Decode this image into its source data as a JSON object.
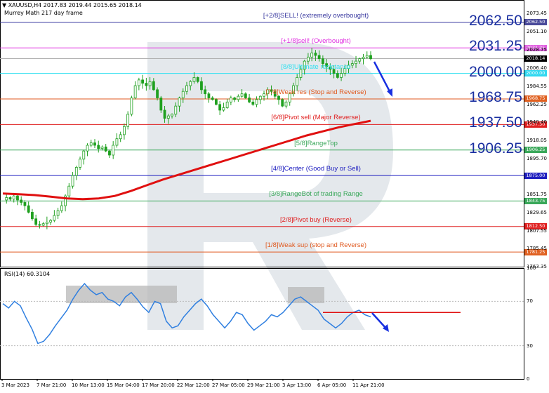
{
  "header": {
    "symbol_line": "XAUUSD,H4  2017.83 2019.44 2015.65 2018.14",
    "indicator": "Murrey Math 217 day frame"
  },
  "rsi_header": "RSI(14) 60.3104",
  "big_labels": [
    "2062.50",
    "2031.25",
    "2000.00",
    "1968.75",
    "1937.50",
    "1906.25"
  ],
  "levels": [
    {
      "price": 2062.5,
      "text": "[+2/8]SELL! (extremely overbought)",
      "color": "#3a3aa0",
      "badge": "2062.50",
      "badge_bg": "#4a4a9a"
    },
    {
      "price": 2031.25,
      "text": "[+1/8]sell! (Overbought)",
      "color": "#e030e0",
      "badge": "2031.25",
      "badge_bg": "#e060e0"
    },
    {
      "price": 2000.0,
      "text": "[8/8]Ultimate resistance",
      "color": "#30e0f0",
      "badge": "2000.00",
      "badge_bg": "#30d8f0"
    },
    {
      "price": 1968.75,
      "text": "[7/8]Weak res (Stop and Reverse)",
      "color": "#e05a20",
      "badge": "1968.75",
      "badge_bg": "#e06020"
    },
    {
      "price": 1937.5,
      "text": "[6/8]Pivot sell (Major Reverse)",
      "color": "#e02020",
      "badge": "1937.50",
      "badge_bg": "#e02020"
    },
    {
      "price": 1906.25,
      "text": "[5/8]RangeTop",
      "color": "#3aa85a",
      "badge": "1906.25",
      "badge_bg": "#3aa85a"
    },
    {
      "price": 1875.0,
      "text": "[4/8]Center (Good Buy or Sell)",
      "color": "#2020c0",
      "badge": "1875.00",
      "badge_bg": "#2020c0"
    },
    {
      "price": 1843.75,
      "text": "[3/8]RangeBot of trading Range",
      "color": "#3aa85a",
      "badge": "1843.75",
      "badge_bg": "#3aa85a"
    },
    {
      "price": 1812.5,
      "text": "[2/8]Pivot buy (Reverse)",
      "color": "#e02020",
      "badge": "1812.50",
      "badge_bg": "#e02020"
    },
    {
      "price": 1781.25,
      "text": "[1/8]Weak sup (stop and Reverse)",
      "color": "#e05a20",
      "badge": "1781.25",
      "badge_bg": "#e06020"
    }
  ],
  "price_ticks": [
    "2073.45",
    "2051.10",
    "2028.75",
    "2006.40",
    "1984.55",
    "1962.25",
    "1940.40",
    "1918.05",
    "1895.70",
    "1851.75",
    "1829.65",
    "1807.55",
    "1785.45",
    "1763.35"
  ],
  "current_price": "2018.14",
  "rsi_ticks": [
    "100",
    "70",
    "30",
    "0"
  ],
  "x_labels": [
    "3 Mar 2023",
    "7 Mar 21:00",
    "10 Mar 13:00",
    "15 Mar 04:00",
    "17 Mar 20:00",
    "22 Mar 12:00",
    "27 Mar 05:00",
    "29 Mar 21:00",
    "3 Apr 13:00",
    "6 Apr 05:00",
    "11 Apr 21:00"
  ],
  "chart_data": {
    "type": "candlestick",
    "symbol": "XAUUSD",
    "timeframe": "H4",
    "ohlc_last": {
      "open": 2017.83,
      "high": 2019.44,
      "low": 2015.65,
      "close": 2018.14
    },
    "ylim": [
      1763.35,
      2083
    ],
    "close_path": [
      1845,
      1848,
      1846,
      1850,
      1845,
      1842,
      1838,
      1830,
      1822,
      1815,
      1814,
      1816,
      1818,
      1820,
      1826,
      1832,
      1838,
      1850,
      1862,
      1875,
      1885,
      1895,
      1905,
      1912,
      1915,
      1912,
      1908,
      1910,
      1905,
      1900,
      1912,
      1920,
      1925,
      1935,
      1950,
      1970,
      1985,
      1992,
      1988,
      1985,
      1990,
      1980,
      1970,
      1955,
      1945,
      1948,
      1950,
      1960,
      1970,
      1978,
      1985,
      1990,
      1995,
      1990,
      1980,
      1975,
      1970,
      1968,
      1962,
      1955,
      1958,
      1965,
      1970,
      1968,
      1972,
      1975,
      1970,
      1965,
      1962,
      1968,
      1972,
      1975,
      1980,
      1978,
      1972,
      1968,
      1960,
      1965,
      1975,
      1985,
      1995,
      2005,
      2015,
      2020,
      2025,
      2022,
      2018,
      2012,
      2008,
      2005,
      2000,
      1995,
      2000,
      2006,
      2010,
      2012,
      2015,
      2018,
      2020,
      2022,
      2018
    ],
    "ma_label": "Murrey Math 217 day frame",
    "moving_average": [
      1853,
      1852,
      1851,
      1849,
      1847,
      1846,
      1847,
      1850,
      1856,
      1863,
      1870,
      1876,
      1882,
      1888,
      1894,
      1900,
      1906,
      1912,
      1918,
      1924,
      1929,
      1934,
      1938,
      1942
    ],
    "rsi": {
      "name": "RSI(14)",
      "last": 60.3104,
      "ylim": [
        0,
        100
      ],
      "levels": [
        70,
        30
      ],
      "values": [
        68,
        64,
        70,
        66,
        55,
        45,
        32,
        34,
        40,
        48,
        55,
        62,
        72,
        80,
        86,
        80,
        76,
        78,
        72,
        70,
        66,
        74,
        78,
        72,
        65,
        60,
        70,
        68,
        52,
        46,
        48,
        56,
        62,
        68,
        72,
        66,
        58,
        52,
        46,
        52,
        60,
        58,
        50,
        44,
        48,
        52,
        58,
        56,
        60,
        66,
        72,
        74,
        70,
        66,
        62,
        54,
        50,
        46,
        50,
        56,
        60,
        62,
        58,
        56
      ],
      "horizontal_line": 60
    },
    "x_tick_labels": [
      "3 Mar 2023",
      "7 Mar 21:00",
      "10 Mar 13:00",
      "15 Mar 04:00",
      "17 Mar 20:00",
      "22 Mar 12:00",
      "27 Mar 05:00",
      "29 Mar 21:00",
      "3 Apr 13:00",
      "6 Apr 05:00",
      "11 Apr 21:00"
    ]
  },
  "colors": {
    "bull": "#1fa01f",
    "bear": "#1fa01f",
    "ma": "#e01010",
    "rsi": "#2f7fe0",
    "arrow": "#1830e0",
    "watermark": "#e4e8ec"
  }
}
